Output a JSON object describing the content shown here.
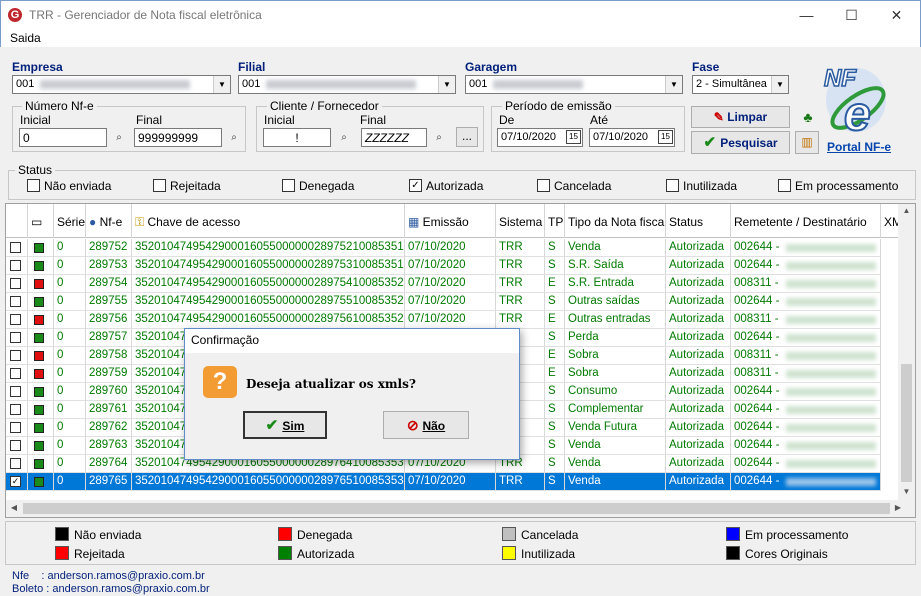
{
  "window": {
    "title": "TRR - Gerenciador de Nota fiscal eletrônica",
    "minimize": "—",
    "maximize": "☐",
    "close": "✕"
  },
  "menu": {
    "saida": "Saida"
  },
  "filters": {
    "empresa": {
      "label": "Empresa",
      "value": "001"
    },
    "filial": {
      "label": "Filial",
      "value": "001"
    },
    "garagem": {
      "label": "Garagem",
      "value": "001"
    },
    "fase": {
      "label": "Fase",
      "value": "2 - Simultânea"
    },
    "numero_nfe": {
      "title": "Número Nf-e",
      "inicial_label": "Inicial",
      "inicial": "0",
      "final_label": "Final",
      "final": "999999999"
    },
    "cliente": {
      "title": "Cliente / Fornecedor",
      "inicial_label": "Inicial",
      "inicial": "!",
      "final_label": "Final",
      "final": "ZZZZZZ",
      "more": "..."
    },
    "periodo": {
      "title": "Período de emissão",
      "de_label": "De",
      "de": "07/10/2020",
      "ate_label": "Até",
      "ate": "07/10/2020",
      "cal": "15"
    },
    "limpar": "Limpar",
    "pesquisar": "Pesquisar",
    "portal": "Portal NF-e"
  },
  "status": {
    "title": "Status",
    "items": [
      {
        "label": "Não enviada",
        "checked": false
      },
      {
        "label": "Rejeitada",
        "checked": false
      },
      {
        "label": "Denegada",
        "checked": false
      },
      {
        "label": "Autorizada",
        "checked": true
      },
      {
        "label": "Cancelada",
        "checked": false
      },
      {
        "label": "Inutilizada",
        "checked": false
      },
      {
        "label": "Em processamento",
        "checked": false
      }
    ]
  },
  "grid": {
    "headers": [
      "Série",
      "Nf-e",
      "Chave de acesso",
      "Emissão",
      "Sistema",
      "TP",
      "Tipo da Nota fiscal",
      "Status",
      "Remetente / Destinatário",
      "XMl"
    ],
    "rows": [
      {
        "sel": false,
        "checked": false,
        "stat": "#1a8a1a",
        "serie": "0",
        "nfe": "289752",
        "chave": "35201047495429000160550000002897521008535188",
        "emissao": "07/10/2020",
        "sistema": "TRR",
        "tp": "S",
        "tipo": "Venda",
        "status": "Autorizada",
        "rem": "002644 -"
      },
      {
        "sel": false,
        "checked": false,
        "stat": "#1a8a1a",
        "serie": "0",
        "nfe": "289753",
        "chave": "35201047495429000160550000002897531008535193",
        "emissao": "07/10/2020",
        "sistema": "TRR",
        "tp": "S",
        "tipo": "S.R. Saída",
        "status": "Autorizada",
        "rem": "002644 -"
      },
      {
        "sel": false,
        "checked": false,
        "stat": "#e01010",
        "serie": "0",
        "nfe": "289754",
        "chave": "35201047495429000160550000002897541008535204",
        "emissao": "07/10/2020",
        "sistema": "TRR",
        "tp": "E",
        "tipo": "S.R. Entrada",
        "status": "Autorizada",
        "rem": "008311 -"
      },
      {
        "sel": false,
        "checked": false,
        "stat": "#1a8a1a",
        "serie": "0",
        "nfe": "289755",
        "chave": "35201047495429000160550000002897551008535210",
        "emissao": "07/10/2020",
        "sistema": "TRR",
        "tp": "S",
        "tipo": "Outras saídas",
        "status": "Autorizada",
        "rem": "002644 -"
      },
      {
        "sel": false,
        "checked": false,
        "stat": "#e01010",
        "serie": "0",
        "nfe": "289756",
        "chave": "35201047495429000160550000002897561008535225",
        "emissao": "07/10/2020",
        "sistema": "TRR",
        "tp": "E",
        "tipo": "Outras entradas",
        "status": "Autorizada",
        "rem": "008311 -"
      },
      {
        "sel": false,
        "checked": false,
        "stat": "#1a8a1a",
        "serie": "0",
        "nfe": "289757",
        "chave": "352010474",
        "emissao": "",
        "sistema": "",
        "tp": "S",
        "tipo": "Perda",
        "status": "Autorizada",
        "rem": "002644 -"
      },
      {
        "sel": false,
        "checked": false,
        "stat": "#e01010",
        "serie": "0",
        "nfe": "289758",
        "chave": "352010474",
        "emissao": "",
        "sistema": "",
        "tp": "E",
        "tipo": "Sobra",
        "status": "Autorizada",
        "rem": "008311 -"
      },
      {
        "sel": false,
        "checked": false,
        "stat": "#e01010",
        "serie": "0",
        "nfe": "289759",
        "chave": "352010474",
        "emissao": "",
        "sistema": "",
        "tp": "E",
        "tipo": "Sobra",
        "status": "Autorizada",
        "rem": "008311 -"
      },
      {
        "sel": false,
        "checked": false,
        "stat": "#1a8a1a",
        "serie": "0",
        "nfe": "289760",
        "chave": "352010474",
        "emissao": "",
        "sistema": "",
        "tp": "S",
        "tipo": "Consumo",
        "status": "Autorizada",
        "rem": "002644 -"
      },
      {
        "sel": false,
        "checked": false,
        "stat": "#1a8a1a",
        "serie": "0",
        "nfe": "289761",
        "chave": "352010474",
        "emissao": "",
        "sistema": "",
        "tp": "S",
        "tipo": "Complementar",
        "status": "Autorizada",
        "rem": "002644 -"
      },
      {
        "sel": false,
        "checked": false,
        "stat": "#1a8a1a",
        "serie": "0",
        "nfe": "289762",
        "chave": "352010474",
        "emissao": "",
        "sistema": "",
        "tp": "S",
        "tipo": "Venda Futura",
        "status": "Autorizada",
        "rem": "002644 -"
      },
      {
        "sel": false,
        "checked": false,
        "stat": "#1a8a1a",
        "serie": "0",
        "nfe": "289763",
        "chave": "352010474",
        "emissao": "",
        "sistema": "",
        "tp": "S",
        "tipo": "Venda",
        "status": "Autorizada",
        "rem": "002644 -"
      },
      {
        "sel": false,
        "checked": false,
        "stat": "#1a8a1a",
        "serie": "0",
        "nfe": "289764",
        "chave": "35201047495429000160550000002897641008535332",
        "emissao": "07/10/2020",
        "sistema": "TRR",
        "tp": "S",
        "tipo": "Venda",
        "status": "Autorizada",
        "rem": "002644 -"
      },
      {
        "sel": true,
        "checked": true,
        "stat": "#1a8a1a",
        "serie": "0",
        "nfe": "289765",
        "chave": "35201047495429000160550000002897651008535348",
        "emissao": "07/10/2020",
        "sistema": "TRR",
        "tp": "S",
        "tipo": "Venda",
        "status": "Autorizada",
        "rem": "002644 -"
      }
    ]
  },
  "legend": [
    {
      "label": "Não enviada",
      "color": "#000000"
    },
    {
      "label": "Denegada",
      "color": "#ff0000"
    },
    {
      "label": "Cancelada",
      "color": "#bfbfbf"
    },
    {
      "label": "Em processamento",
      "color": "#0000ff"
    },
    {
      "label": "Rejeitada",
      "color": "#ff0000"
    },
    {
      "label": "Autorizada",
      "color": "#008000"
    },
    {
      "label": "Inutilizada",
      "color": "#ffff00"
    },
    {
      "label": "Cores Originais",
      "color": "#000000"
    }
  ],
  "footer": {
    "nfe_label": "Nfe",
    "nfe_email": "anderson.ramos@praxio.com.br",
    "boleto_label": "Boleto",
    "boleto_email": "anderson.ramos@praxio.com.br"
  },
  "dialog": {
    "title": "Confirmação",
    "message": "Deseja atualizar os xmls?",
    "yes": "Sim",
    "no": "Não"
  }
}
